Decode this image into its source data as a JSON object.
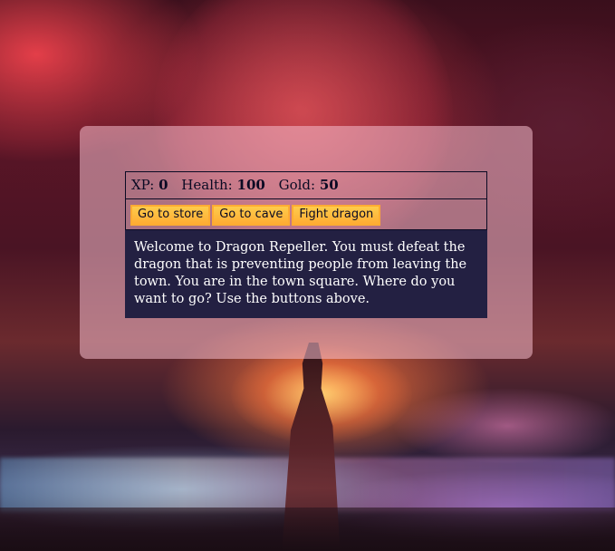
{
  "stats": {
    "xp_label": "XP:",
    "xp_value": "0",
    "health_label": "Health:",
    "health_value": "100",
    "gold_label": "Gold:",
    "gold_value": "50"
  },
  "controls": {
    "button1_label": "Go to store",
    "button2_label": "Go to cave",
    "button3_label": "Fight dragon"
  },
  "text": "Welcome to Dragon Repeller. You must defeat the dragon that is preventing people from leaving the town. You are in the town square. Where do you want to go? Use the buttons above.",
  "colors": {
    "button": "#feac32",
    "text_background": "#232042",
    "panel": "#f5becd"
  }
}
